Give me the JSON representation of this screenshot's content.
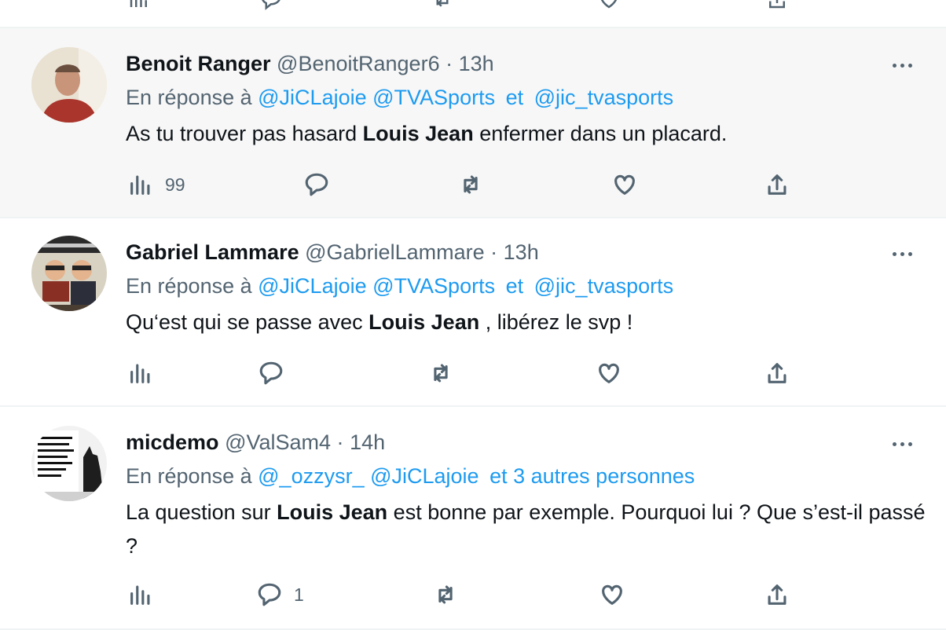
{
  "icons": {
    "views": "bar-chart-icon",
    "reply": "speech-bubble-icon",
    "retweet": "retweet-arrows-icon",
    "like": "heart-icon",
    "share": "share-upload-icon",
    "more": "more-dots-icon"
  },
  "colors": {
    "accent": "#1d9bf0",
    "muted": "#536471",
    "text": "#0f1419",
    "highlight_bg": "#f7f7f7"
  },
  "tweets": [
    {
      "name": "Benoit Ranger",
      "handle": "@BenoitRanger6",
      "dot": "·",
      "time": "13h",
      "reply_prefix": "En réponse à",
      "mentions": [
        "@JiCLajoie",
        "@TVASports",
        "et",
        "@jic_tvasports"
      ],
      "text_before": "As tu trouver pas hasard ",
      "text_bold": "Louis Jean",
      "text_after": " enfermer dans un placard.",
      "views": "99",
      "replies": ""
    },
    {
      "name": "Gabriel Lammare",
      "handle": "@GabrielLammare",
      "dot": "·",
      "time": "13h",
      "reply_prefix": "En réponse à",
      "mentions": [
        "@JiCLajoie",
        "@TVASports",
        "et",
        "@jic_tvasports"
      ],
      "text_before": "Qu‘est qui se passe avec ",
      "text_bold": "Louis Jean",
      "text_after": " , libérez le svp !",
      "views": "",
      "replies": ""
    },
    {
      "name": "micdemo",
      "handle": "@ValSam4",
      "dot": "·",
      "time": "14h",
      "reply_prefix": "En réponse à",
      "mentions": [
        "@_ozzysr_",
        "@JiCLajoie",
        "et 3 autres personnes"
      ],
      "text_before": "La question sur ",
      "text_bold": "Louis Jean",
      "text_after": " est bonne par exemple. Pourquoi lui ? Que s’est-il passé ?",
      "views": "",
      "replies": "1"
    }
  ]
}
